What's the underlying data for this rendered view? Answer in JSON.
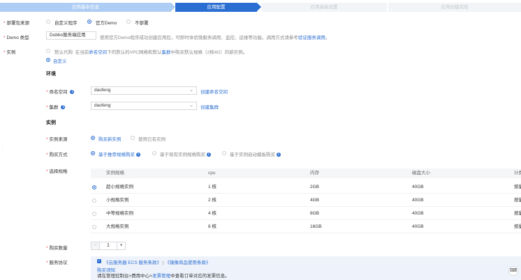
{
  "steps": [
    {
      "label": "应用基本信息",
      "state": "done"
    },
    {
      "label": "应用配置",
      "state": "active"
    },
    {
      "label": "应用高级设置",
      "state": "todo"
    },
    {
      "label": "应用创建完成",
      "state": "todo"
    }
  ],
  "deploy_source": {
    "label": "部署包来源",
    "options": [
      "自定义程序",
      "官方Demo",
      "不部署"
    ],
    "selected": 1
  },
  "demo_type": {
    "label": "Demo 类型",
    "value": "Dubbo服务端应用",
    "desc_prefix": "使用官方Demo程序成功创建应用后，可即时体验微服务调用、监控、运维等功能。调用方式请参考",
    "desc_link": "验证服务调用",
    "desc_suffix": "。"
  },
  "instance": {
    "label": "实例",
    "option_default": "默认代购",
    "default_desc_1": "在当前",
    "default_desc_link1": "命名空间",
    "default_desc_2": "下的默认的VPC网络和默认",
    "default_desc_link2": "集群",
    "default_desc_3": "中购买默认规格（2核4G）的新实例。",
    "option_custom": "自定义"
  },
  "env": {
    "title": "环境",
    "namespace_label": "命名空间",
    "namespace_value": "daofeng",
    "namespace_link": "创建命名空间",
    "cluster_label": "集群",
    "cluster_value": "daofeng",
    "cluster_link": "创建集群"
  },
  "inst": {
    "title": "实例",
    "source_label": "实例来源",
    "source_options": [
      "购买新实例",
      "使用已有实例"
    ],
    "source_selected": 0,
    "method_label": "购买方式",
    "method_options": [
      "基于推荐规格购买",
      "基于现有实例规格购买",
      "基于实例启动模板购买"
    ],
    "method_selected": 0,
    "spec_label": "选择规格"
  },
  "spec_table": {
    "headers": [
      "实例规格",
      "cpu",
      "内存",
      "磁盘大小",
      "计费"
    ],
    "rows": [
      {
        "name": "超小规格实例",
        "cpu": "1 核",
        "mem": "2GB",
        "disk": "40GB",
        "billing": "按量"
      },
      {
        "name": "小规格实例",
        "cpu": "2 核",
        "mem": "4GB",
        "disk": "40GB",
        "billing": "按量"
      },
      {
        "name": "中等规格实例",
        "cpu": "4 核",
        "mem": "8GB",
        "disk": "40GB",
        "billing": "按量"
      },
      {
        "name": "大规格实例",
        "cpu": "8 核",
        "mem": "16GB",
        "disk": "40GB",
        "billing": "按量"
      }
    ],
    "selected": 0
  },
  "quantity": {
    "label": "购买数量",
    "minus": "−",
    "value": "1",
    "plus": "+"
  },
  "agreement": {
    "label": "服务协议",
    "terms1": "《云服务器 ECS 服务条款》",
    "sep": "|",
    "terms2": "《镜像商品使用条款》",
    "notice_title": "购买须知",
    "notice_1a": "请在管理控制台>费用中心>",
    "notice_1link": "发票管理",
    "notice_1b": "中查看订单对应的发票信息。"
  },
  "colors": {
    "accent": "#2b6ed2",
    "required": "#e54545"
  }
}
